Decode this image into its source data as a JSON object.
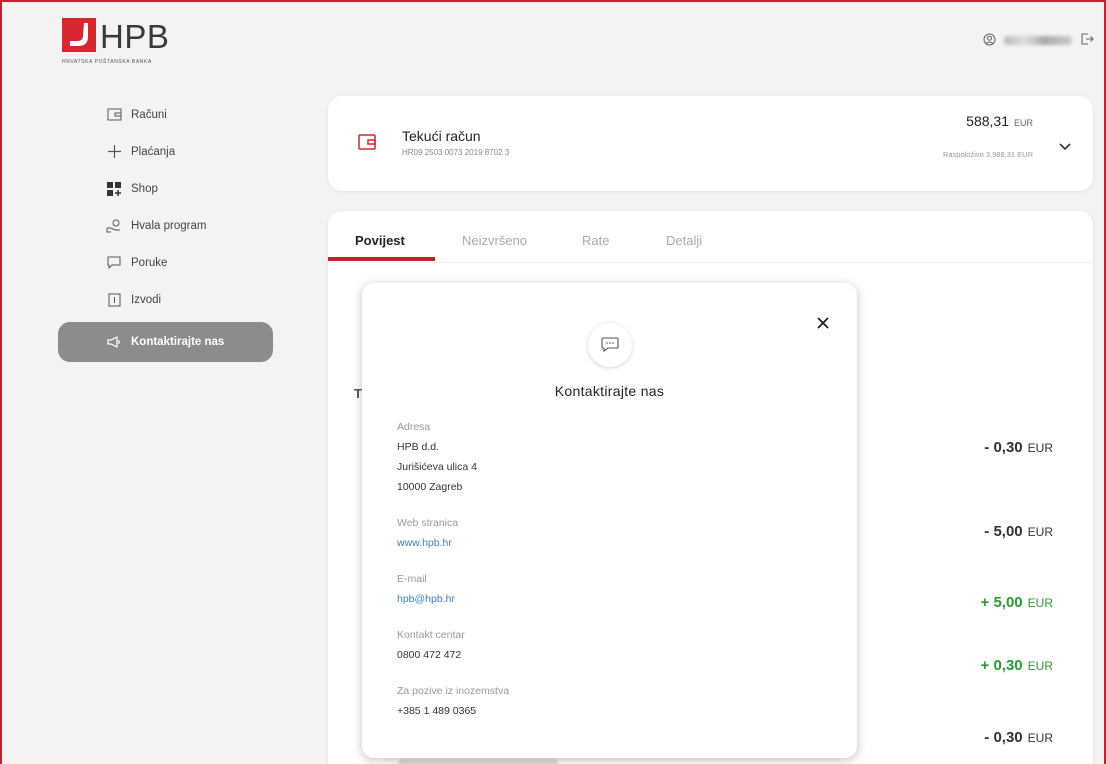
{
  "brand": {
    "logo_text": "HPB",
    "logo_subtitle": "HRVATSKA POŠTANSKA BANKA",
    "accent_color": "#d7272f"
  },
  "header": {
    "user_icon": "user-circle-icon",
    "logout_icon": "logout-icon"
  },
  "sidebar": {
    "items": [
      {
        "label": "Računi",
        "icon": "wallet-icon"
      },
      {
        "label": "Plaćanja",
        "icon": "plus-icon"
      },
      {
        "label": "Shop",
        "icon": "grid-icon"
      },
      {
        "label": "Hvala program",
        "icon": "loyalty-icon"
      },
      {
        "label": "Poruke",
        "icon": "message-icon"
      },
      {
        "label": "Izvodi",
        "icon": "document-icon"
      },
      {
        "label": "Kontaktirajte nas",
        "icon": "megaphone-icon",
        "active": true
      }
    ]
  },
  "account": {
    "name": "Tekući račun",
    "iban": "HR09 2503 0073 2019 8702 3",
    "balance": "588,31",
    "currency": "EUR",
    "available": "Raspoloživo 3.988,31 EUR"
  },
  "tabs": [
    {
      "label": "Povijest",
      "active": true
    },
    {
      "label": "Neizvršeno"
    },
    {
      "label": "Rate"
    },
    {
      "label": "Detalji"
    }
  ],
  "transactions": [
    {
      "amount": "- 0,30",
      "currency": "EUR",
      "positive": false
    },
    {
      "amount": "- 5,00",
      "currency": "EUR",
      "positive": false
    },
    {
      "amount": "+ 5,00",
      "currency": "EUR",
      "positive": true
    },
    {
      "amount": "+ 0,30",
      "currency": "EUR",
      "positive": true
    },
    {
      "amount": "- 0,30",
      "currency": "EUR",
      "positive": false
    }
  ],
  "background_partial_letter": "T",
  "modal": {
    "title": "Kontaktirajte nas",
    "fields": {
      "address": {
        "label": "Adresa",
        "lines": [
          "HPB d.d.",
          "Jurišićeva ulica 4",
          "10000 Zagreb"
        ]
      },
      "web": {
        "label": "Web stranica",
        "value": "www.hpb.hr"
      },
      "email": {
        "label": "E-mail",
        "value": "hpb@hpb.hr"
      },
      "contact_center": {
        "label": "Kontakt centar",
        "value": "0800 472 472"
      },
      "abroad": {
        "label": "Za pozive iz inozemstva",
        "value": "+385 1 489 0365"
      }
    }
  },
  "colors": {
    "positive": "#2e9a33",
    "link": "#3d7fc4",
    "active_nav": "#8b8c8e"
  }
}
